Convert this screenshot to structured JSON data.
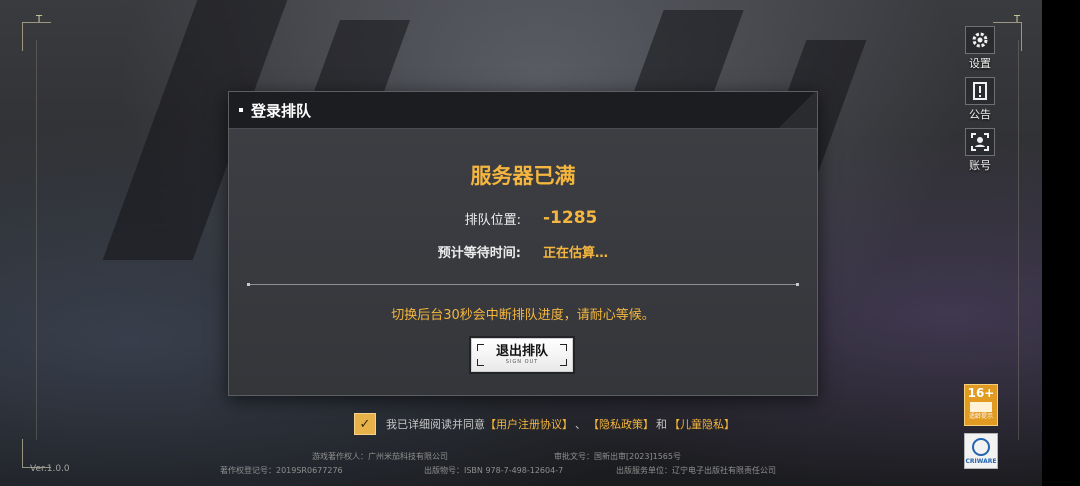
{
  "dialog": {
    "title": "登录排队",
    "status": "服务器已满",
    "queue_label": "排队位置:",
    "queue_value": "-1285",
    "wait_label": "预计等待时间:",
    "wait_value": "正在估算…",
    "notice": "切换后台30秒会中断排队进度，请耐心等候。",
    "signout_label": "退出排队",
    "signout_sub": "SIGN OUT"
  },
  "side_menu": {
    "settings_label": "设置",
    "notice_label": "公告",
    "account_label": "账号"
  },
  "agreement": {
    "text": "我已详细阅读并同意",
    "link_terms": "【用户注册协议】",
    "separator": "、",
    "link_privacy": "【隐私政策】",
    "and": "和",
    "link_child": "【儿童隐私】"
  },
  "footer": {
    "copyright_holder": "游戏著作权人：广州米茄科技有限公司",
    "approval_no": "审批文号：国新出审[2023]1565号",
    "reg_no": "著作权登记号：2019SR0677276",
    "isbn": "出版物号：ISBN 978-7-498-12604-7",
    "publisher": "出版服务单位：辽宁电子出版社有限责任公司"
  },
  "age_rating": {
    "value": "16+",
    "label": "适龄提示"
  },
  "cri_badge": "CRIWARE",
  "version": "Ver.1.0.0",
  "corner_marker": "T",
  "colors": {
    "accent": "#f4b63e",
    "dialog_bg": "#3d3f44",
    "header_bg": "#1c1d21"
  }
}
